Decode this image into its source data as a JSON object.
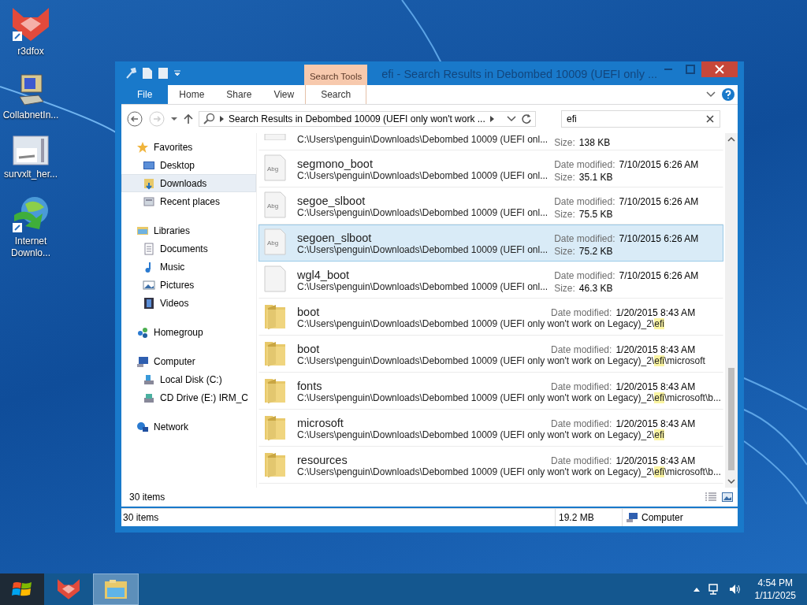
{
  "desktop_icons": [
    {
      "label": "r3dfox",
      "kind": "fox"
    },
    {
      "label": "CollabnetIn...",
      "kind": "computer"
    },
    {
      "label": "survxlt_her...",
      "kind": "document"
    },
    {
      "label": "Internet\nDownlo...",
      "kind": "globe"
    }
  ],
  "window": {
    "title": "efi - Search Results in Debombed 10009 (UEFI only ...",
    "contextual_tab": "Search Tools"
  },
  "ribbon_tabs": [
    {
      "label": "File",
      "kind": "file",
      "selected": false
    },
    {
      "label": "Home",
      "kind": "tab",
      "selected": false
    },
    {
      "label": "Share",
      "kind": "tab",
      "selected": false
    },
    {
      "label": "View",
      "kind": "tab",
      "selected": false
    },
    {
      "label": "Search",
      "kind": "contextual",
      "selected": false
    }
  ],
  "address_bar": {
    "path": "Search Results in Debombed 10009 (UEFI only won't work ..."
  },
  "search": {
    "value": "efi"
  },
  "sidebar": {
    "groups": [
      {
        "label": "Favorites",
        "kind": "star",
        "children": [
          {
            "label": "Desktop",
            "kind": "desktop",
            "selected": false
          },
          {
            "label": "Downloads",
            "kind": "downloads",
            "selected": true
          },
          {
            "label": "Recent places",
            "kind": "recent",
            "selected": false
          }
        ]
      },
      {
        "label": "Libraries",
        "kind": "library",
        "children": [
          {
            "label": "Documents",
            "kind": "documents",
            "selected": false
          },
          {
            "label": "Music",
            "kind": "music",
            "selected": false
          },
          {
            "label": "Pictures",
            "kind": "pictures",
            "selected": false
          },
          {
            "label": "Videos",
            "kind": "videos",
            "selected": false
          }
        ]
      },
      {
        "label": "Homegroup",
        "kind": "homegroup"
      },
      {
        "label": "Computer",
        "kind": "computer",
        "children": [
          {
            "label": "Local Disk (C:)",
            "kind": "disk",
            "selected": false
          },
          {
            "label": "CD Drive (E:) IRM_C",
            "kind": "cd",
            "selected": false
          }
        ]
      },
      {
        "label": "Network",
        "kind": "network"
      }
    ]
  },
  "results": [
    {
      "kind": "partial",
      "path": [
        {
          "text": "C:\\Users\\penguin\\Downloads\\Debombed 10009 (UEFI onl...",
          "highlight": false
        }
      ],
      "size_label": "Size:",
      "size": "138 KB",
      "selected": false
    },
    {
      "kind": "font",
      "icon_text": "Abg",
      "name": "segmono_boot",
      "path": [
        {
          "text": "C:\\Users\\penguin\\Downloads\\Debombed 10009 (UEFI onl...",
          "highlight": false
        }
      ],
      "date_label": "Date modified:",
      "date": "7/10/2015 6:26 AM",
      "size_label": "Size:",
      "size": "35.1 KB",
      "selected": false
    },
    {
      "kind": "font",
      "icon_text": "Abg",
      "name": "segoe_slboot",
      "path": [
        {
          "text": "C:\\Users\\penguin\\Downloads\\Debombed 10009 (UEFI onl...",
          "highlight": false
        }
      ],
      "date_label": "Date modified:",
      "date": "7/10/2015 6:26 AM",
      "size_label": "Size:",
      "size": "75.5 KB",
      "selected": false
    },
    {
      "kind": "font",
      "icon_text": "Abg",
      "name": "segoen_slboot",
      "path": [
        {
          "text": "C:\\Users\\penguin\\Downloads\\Debombed 10009 (UEFI onl...",
          "highlight": false
        }
      ],
      "date_label": "Date modified:",
      "date": "7/10/2015 6:26 AM",
      "size_label": "Size:",
      "size": "75.2 KB",
      "selected": true
    },
    {
      "kind": "file",
      "name": "wgl4_boot",
      "path": [
        {
          "text": "C:\\Users\\penguin\\Downloads\\Debombed 10009 (UEFI onl...",
          "highlight": false
        }
      ],
      "date_label": "Date modified:",
      "date": "7/10/2015 6:26 AM",
      "size_label": "Size:",
      "size": "46.3 KB",
      "selected": false
    },
    {
      "kind": "folder",
      "name": "boot",
      "path": [
        {
          "text": "C:\\Users\\penguin\\Downloads\\Debombed 10009 (UEFI only won't work on Legacy)_2\\",
          "highlight": false
        },
        {
          "text": "efi",
          "highlight": true
        }
      ],
      "date_label": "Date modified:",
      "date": "1/20/2015 8:43 AM",
      "selected": false
    },
    {
      "kind": "folder",
      "name": "boot",
      "path": [
        {
          "text": "C:\\Users\\penguin\\Downloads\\Debombed 10009 (UEFI only won't work on Legacy)_2\\",
          "highlight": false
        },
        {
          "text": "efi",
          "highlight": true
        },
        {
          "text": "\\microsoft",
          "highlight": false
        }
      ],
      "date_label": "Date modified:",
      "date": "1/20/2015 8:43 AM",
      "selected": false
    },
    {
      "kind": "folder",
      "name": "fonts",
      "path": [
        {
          "text": "C:\\Users\\penguin\\Downloads\\Debombed 10009 (UEFI only won't work on Legacy)_2\\",
          "highlight": false
        },
        {
          "text": "efi",
          "highlight": true
        },
        {
          "text": "\\microsoft\\b...",
          "highlight": false
        }
      ],
      "date_label": "Date modified:",
      "date": "1/20/2015 8:43 AM",
      "selected": false
    },
    {
      "kind": "folder",
      "name": "microsoft",
      "path": [
        {
          "text": "C:\\Users\\penguin\\Downloads\\Debombed 10009 (UEFI only won't work on Legacy)_2\\",
          "highlight": false
        },
        {
          "text": "efi",
          "highlight": true
        }
      ],
      "date_label": "Date modified:",
      "date": "1/20/2015 8:43 AM",
      "selected": false
    },
    {
      "kind": "folder",
      "name": "resources",
      "path": [
        {
          "text": "C:\\Users\\penguin\\Downloads\\Debombed 10009 (UEFI only won't work on Legacy)_2\\",
          "highlight": false
        },
        {
          "text": "efi",
          "highlight": true
        },
        {
          "text": "\\microsoft\\b...",
          "highlight": false
        }
      ],
      "date_label": "Date modified:",
      "date": "1/20/2015 8:43 AM",
      "selected": false
    }
  ],
  "details_pane": {
    "count": "30 items"
  },
  "status_bar": {
    "count": "30 items",
    "size": "19.2 MB",
    "location": "Computer"
  },
  "taskbar": {
    "apps": [
      {
        "kind": "fox",
        "selected": false
      },
      {
        "kind": "explorer",
        "selected": true
      }
    ],
    "time": "4:54 PM",
    "date": "1/11/2025"
  }
}
